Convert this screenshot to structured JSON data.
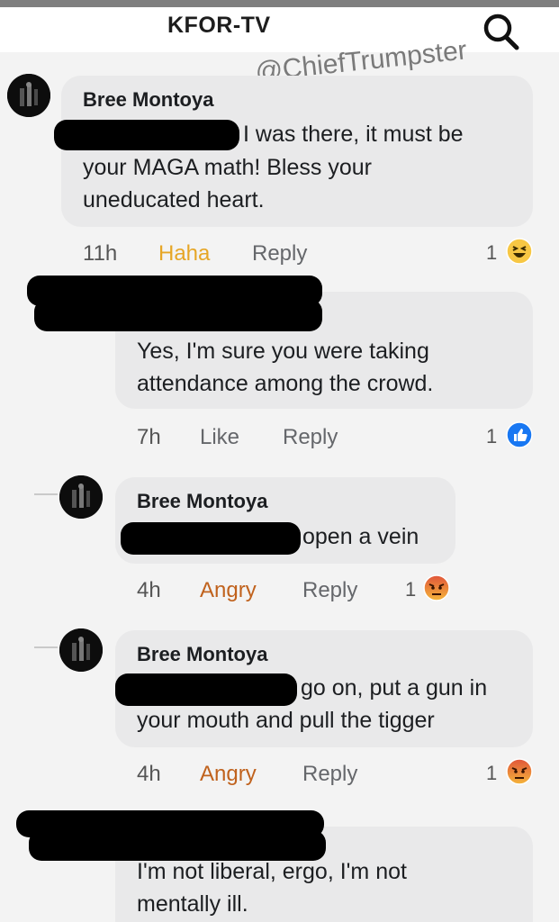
{
  "header": {
    "title": "KFOR-TV"
  },
  "watermark": "@ChiefTrumpster",
  "comments": [
    {
      "author": "Bree Montoya",
      "line1": "I was there, it must be",
      "line2": "your MAGA math! Bless your",
      "line3": "uneducated heart.",
      "time": "11h",
      "reaction_label": "Haha",
      "reply_label": "Reply",
      "count": "1"
    },
    {
      "line1": "Yes, I'm sure you were taking",
      "line2": "attendance among the crowd.",
      "time": "7h",
      "reaction_label": "Like",
      "reply_label": "Reply",
      "count": "1"
    },
    {
      "author": "Bree Montoya",
      "line1": "open a vein",
      "time": "4h",
      "reaction_label": "Angry",
      "reply_label": "Reply",
      "count": "1"
    },
    {
      "author": "Bree Montoya",
      "line1": "go on, put a gun in",
      "line2": "your mouth and pull the tigger",
      "time": "4h",
      "reaction_label": "Angry",
      "reply_label": "Reply",
      "count": "1"
    },
    {
      "line1": "I'm not liberal, ergo, I'm not",
      "line2": "mentally ill."
    }
  ],
  "icons": {
    "search": "search-icon",
    "haha": "haha-reaction-icon",
    "like": "like-reaction-icon",
    "angry": "angry-reaction-icon"
  },
  "colors": {
    "haha": "#e6a626",
    "angry": "#c0621d",
    "like_blue": "#1877f2",
    "bubble": "#e9e9ea"
  }
}
